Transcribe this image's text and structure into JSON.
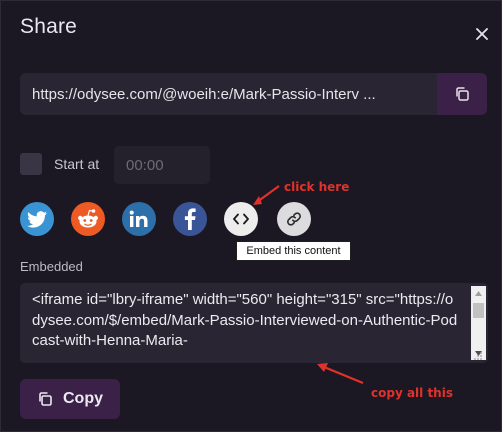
{
  "dialog": {
    "title": "Share",
    "close_icon": "close-icon"
  },
  "share_url": {
    "value": "https://odysee.com/@woeih:e/Mark-Passio-Interv ...",
    "copy_icon": "copy-icon"
  },
  "start_at": {
    "label": "Start at",
    "checked": false,
    "placeholder": "00:00"
  },
  "social": [
    {
      "name": "twitter",
      "icon": "twitter-icon",
      "color": "#3a94d4"
    },
    {
      "name": "reddit",
      "icon": "reddit-icon",
      "color": "#ed5a23"
    },
    {
      "name": "linkedin",
      "icon": "linkedin-icon",
      "color": "#2d6fa8"
    },
    {
      "name": "facebook",
      "icon": "facebook-icon",
      "color": "#3a5597"
    },
    {
      "name": "embed",
      "icon": "code-icon",
      "color": "#ededee"
    },
    {
      "name": "link",
      "icon": "link-icon",
      "color": "#dcdcdf"
    }
  ],
  "tooltip": {
    "text": "Embed this content"
  },
  "embedded": {
    "label": "Embedded",
    "code": "<iframe id=\"lbry-iframe\" width=\"560\" height=\"315\" src=\"https://odysee.com/$/embed/Mark-Passio-Interviewed-on-Authentic-Podcast-with-Henna-Maria-"
  },
  "copy_button": {
    "label": "Copy",
    "icon": "copy-icon"
  },
  "annotations": {
    "click_here": "click here",
    "copy_all": "copy all this",
    "color": "#e0322b"
  },
  "colors": {
    "background": "#1c1823",
    "input": "#2a2533",
    "accent": "#3b2147"
  }
}
